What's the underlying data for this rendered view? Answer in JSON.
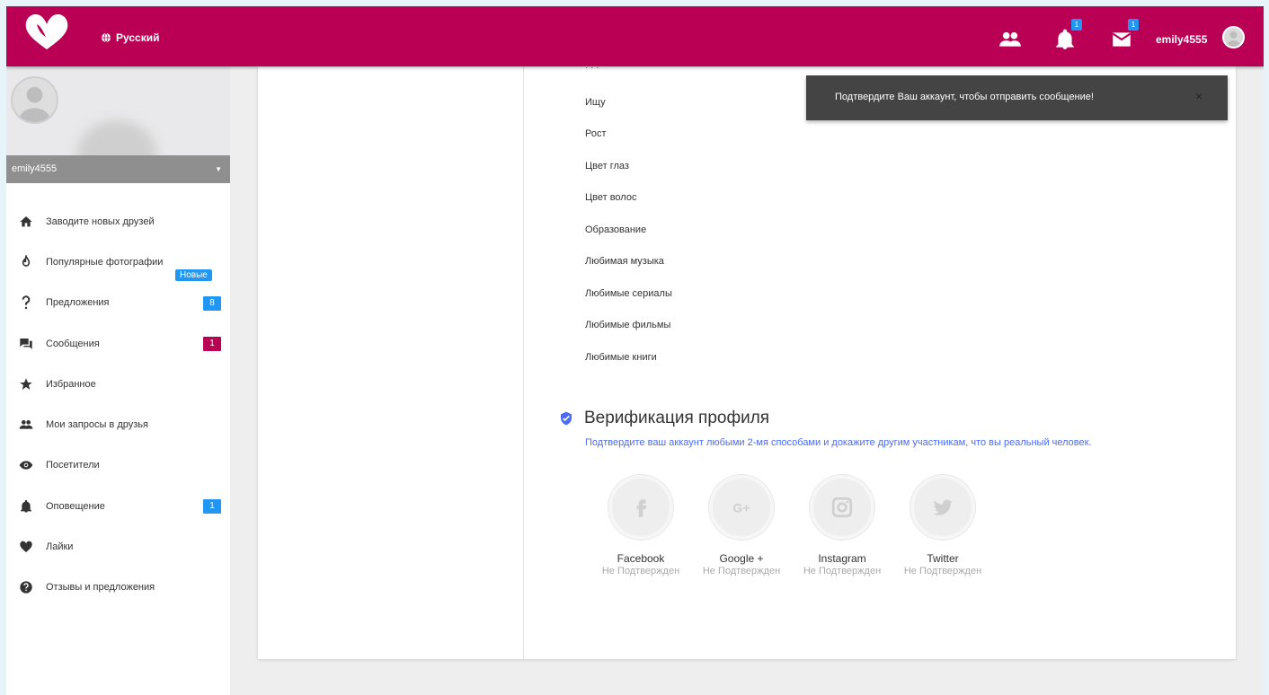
{
  "header": {
    "language": "Русский",
    "friends_badge": "",
    "notifications_badge": "1",
    "messages_badge": "1",
    "username": "emily4555",
    "brand_color": "#b90054"
  },
  "sidebar": {
    "username": "emily4555",
    "new_tag": "Новые",
    "items": [
      {
        "label": "Заводите новых друзей",
        "icon": "home-icon"
      },
      {
        "label": "Популярные фотографии",
        "icon": "fire-icon"
      },
      {
        "label": "Предложения",
        "icon": "question-icon",
        "badge": "8",
        "badge_color": "#2196f3"
      },
      {
        "label": "Сообщения",
        "icon": "chat-icon",
        "badge": "1",
        "badge_color": "#b90054"
      },
      {
        "label": "Избранное",
        "icon": "star-icon"
      },
      {
        "label": "Мои запросы в друзья",
        "icon": "people-icon"
      },
      {
        "label": "Посетители",
        "icon": "eye-icon"
      },
      {
        "label": "Оповещение",
        "icon": "bell-icon",
        "badge": "1",
        "badge_color": "#2196f3"
      },
      {
        "label": "Лайки",
        "icon": "heart-icon"
      },
      {
        "label": "Отзывы и предложения",
        "icon": "help-icon"
      }
    ]
  },
  "profile_fields": [
    "Ищу",
    "Рост",
    "Цвет глаз",
    "Цвет волос",
    "Образование",
    "Любимая музыка",
    "Любимые сериалы",
    "Любимые фильмы",
    "Любимые книги"
  ],
  "verification": {
    "title": "Верификация профиля",
    "description": "Подтвердите ваш аккаунт любыми 2-мя способами и докажите другим участникам, что вы реальный человек.",
    "services": [
      {
        "name": "Facebook",
        "status": "Не Подтвержден",
        "icon": "facebook-icon"
      },
      {
        "name": "Google +",
        "status": "Не Подтвержден",
        "icon": "google-plus-icon"
      },
      {
        "name": "Instagram",
        "status": "Не Подтвержден",
        "icon": "instagram-icon"
      },
      {
        "name": "Twitter",
        "status": "Не Подтвержден",
        "icon": "twitter-icon"
      }
    ]
  },
  "toast": {
    "message": "Подтвердите Ваш аккаунт, чтобы отправить сообщение!",
    "close": "×"
  }
}
